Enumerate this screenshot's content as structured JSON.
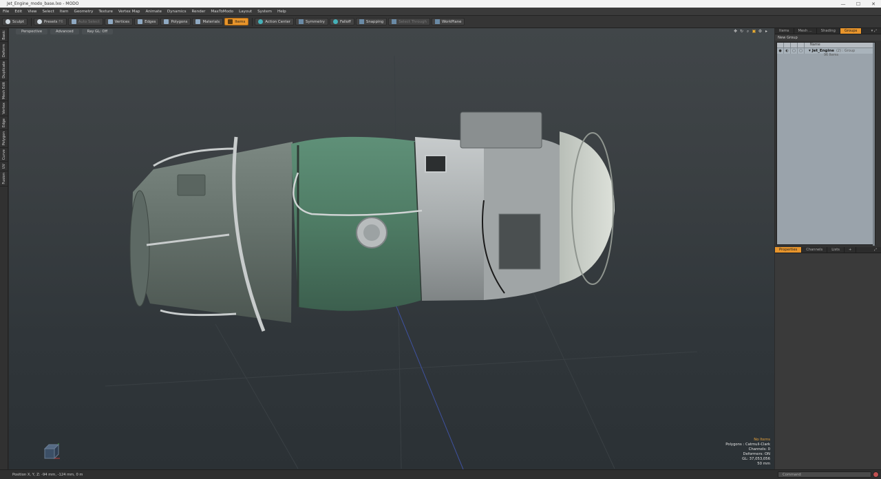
{
  "window": {
    "title": "Jet_Engine_modo_base.lxo - MODO",
    "controls": [
      "—",
      "☐",
      "✕"
    ]
  },
  "menu": [
    "File",
    "Edit",
    "View",
    "Select",
    "Item",
    "Geometry",
    "Texture",
    "Vertex Map",
    "Animate",
    "Dynamics",
    "Render",
    "MaxToModo",
    "Layout",
    "System",
    "Help"
  ],
  "toolbar": {
    "sculpt": "Sculpt",
    "presets": "Presets",
    "presets_key": "F6",
    "auto_select": "Auto Select",
    "vertices": "Vertices",
    "edges": "Edges",
    "polygons": "Polygons",
    "materials": "Materials",
    "items": "Items",
    "action_center": "Action Center",
    "symmetry": "Symmetry",
    "falloff": "Falloff",
    "snapping": "Snapping",
    "select_through": "Select Through",
    "workplane": "WorkPlane"
  },
  "left_tabs": [
    "Basic",
    "Deform",
    "Duplicate",
    "Mesh Edit",
    "Vertex",
    "Edge",
    "Polygon",
    "Curve",
    "UV",
    "Fusion"
  ],
  "viewport": {
    "view": "Perspective",
    "mode": "Advanced",
    "ray_gl": "Ray GL: Off",
    "info": {
      "selection": "No Items",
      "polygons": "Polygons : Catmull-Clark",
      "channels": "Channels: 0",
      "deformers": "Deformers: ON",
      "gl": "GL: 37,053,056",
      "lens": "50 mm"
    }
  },
  "status": {
    "position": "Position X, Y, Z:  -94 mm, -124 mm, 0 m",
    "command_placeholder": "Command"
  },
  "right_top": {
    "tabs": [
      "Items",
      "Mesh ...",
      "Shading",
      "Groups"
    ],
    "active_tab": "Groups",
    "new_group": "New Group",
    "column_name": "Name",
    "group": {
      "name": "Jet_Engine",
      "count": "(2) : Group",
      "sub": "96 Items"
    }
  },
  "right_bottom": {
    "tabs": [
      "Properties",
      "Channels",
      "Lists"
    ],
    "active_tab": "Properties",
    "add": "+"
  },
  "colors": {
    "accent": "#e8952c",
    "viewport_top": "#414649",
    "viewport_bottom": "#2b3135",
    "engine_green": "#4e7b64",
    "engine_gray": "#6d7872"
  }
}
